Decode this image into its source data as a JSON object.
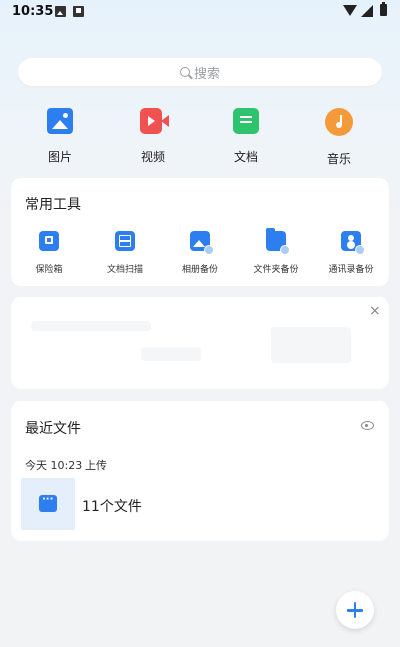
{
  "status_bar": {
    "time": "10:35"
  },
  "search": {
    "placeholder": "搜索"
  },
  "categories": [
    {
      "label": "图片",
      "icon": "picture-icon",
      "color": "#2d7ff0"
    },
    {
      "label": "视频",
      "icon": "video-icon",
      "color": "#f05252"
    },
    {
      "label": "文档",
      "icon": "document-icon",
      "color": "#2fc36d"
    },
    {
      "label": "音乐",
      "icon": "music-icon",
      "color": "#f59a3b"
    }
  ],
  "tools": {
    "title": "常用工具",
    "items": [
      {
        "label": "保险箱",
        "icon": "safe-icon"
      },
      {
        "label": "文档扫描",
        "icon": "scan-icon"
      },
      {
        "label": "相册备份",
        "icon": "album-backup-icon"
      },
      {
        "label": "文件夹备份",
        "icon": "folder-backup-icon"
      },
      {
        "label": "通讯录备份",
        "icon": "contacts-backup-icon"
      }
    ]
  },
  "promo": {
    "close_label": "×"
  },
  "recent": {
    "title": "最近文件",
    "upload_date": "今天 10:23",
    "upload_action": "上传",
    "file_count": "11个文件"
  },
  "colors": {
    "accent": "#2d7ff0",
    "background": "#f2f3f5"
  }
}
